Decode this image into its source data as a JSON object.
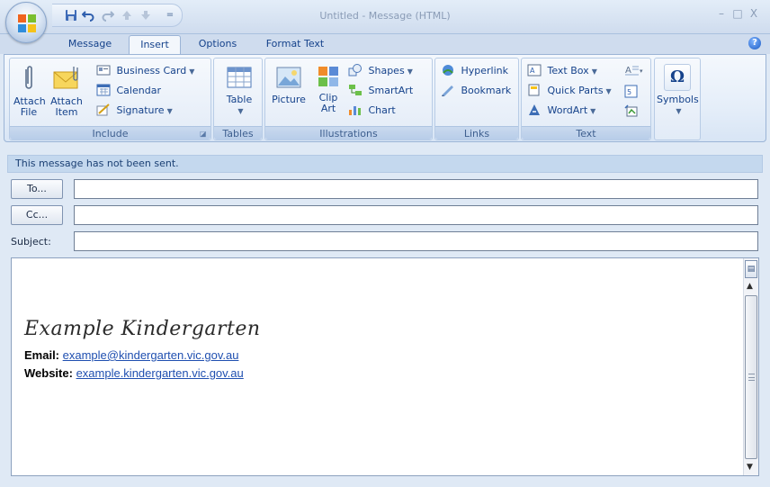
{
  "window": {
    "title": "Untitled - Message (HTML)",
    "minimize": "–",
    "maximize": "□",
    "close": "X"
  },
  "quick_access": {
    "save_icon": "save-icon",
    "undo_icon": "undo-icon",
    "redo_icon": "redo-icon",
    "up_icon": "up-arrow-icon",
    "down_icon": "down-arrow-icon",
    "customize": "="
  },
  "tabs": [
    "Message",
    "Insert",
    "Options",
    "Format Text"
  ],
  "active_tab": "Insert",
  "ribbon": {
    "include": {
      "label": "Include",
      "attach_file": "Attach File",
      "attach_item": "Attach Item",
      "business_card": "Business Card",
      "calendar": "Calendar",
      "signature": "Signature"
    },
    "tables": {
      "label": "Tables",
      "table": "Table"
    },
    "illustrations": {
      "label": "Illustrations",
      "picture": "Picture",
      "clip_art": "Clip Art",
      "shapes": "Shapes",
      "smartart": "SmartArt",
      "chart": "Chart"
    },
    "links": {
      "label": "Links",
      "hyperlink": "Hyperlink",
      "bookmark": "Bookmark"
    },
    "text": {
      "label": "Text",
      "text_box": "Text Box",
      "quick_parts": "Quick Parts",
      "wordart": "WordArt"
    },
    "symbols": {
      "label": "Symbols",
      "glyph": "Ω"
    }
  },
  "message": {
    "notice": "This message has not been sent.",
    "to_label": "To...",
    "cc_label": "Cc...",
    "subject_label": "Subject:",
    "to_value": "",
    "cc_value": "",
    "subject_value": ""
  },
  "signature": {
    "name": "Example Kindergarten",
    "email_label": "Email:",
    "email": "example@kindergarten.vic.gov.au",
    "website_label": "Website:",
    "website": "example.kindergarten.vic.gov.au"
  },
  "colors": {
    "accent": "#15428b",
    "link": "#1f4fb0",
    "ribbon_bg": "#e5eef9"
  }
}
